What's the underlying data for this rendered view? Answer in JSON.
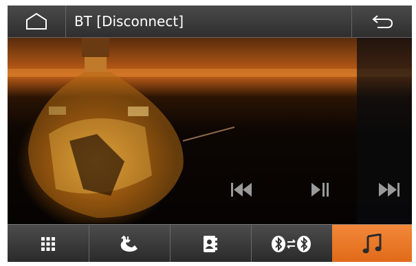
{
  "header": {
    "title": "BT [Disconnect]",
    "home_icon": "home-icon",
    "back_icon": "back-arrow-icon"
  },
  "player": {
    "controls": [
      "previous-track-icon",
      "play-pause-icon",
      "next-track-icon"
    ]
  },
  "bottom_nav": {
    "tabs": [
      {
        "icon": "dialpad-icon",
        "active": false
      },
      {
        "icon": "call-log-icon",
        "active": false
      },
      {
        "icon": "contacts-icon",
        "active": false
      },
      {
        "icon": "bluetooth-connect-icon",
        "active": false
      },
      {
        "icon": "music-note-icon",
        "active": true
      }
    ]
  },
  "colors": {
    "accent": "#e97a28",
    "bar": "#3a3a3a",
    "icon": "#ffffff",
    "control_icon": "#9a9a9a"
  }
}
